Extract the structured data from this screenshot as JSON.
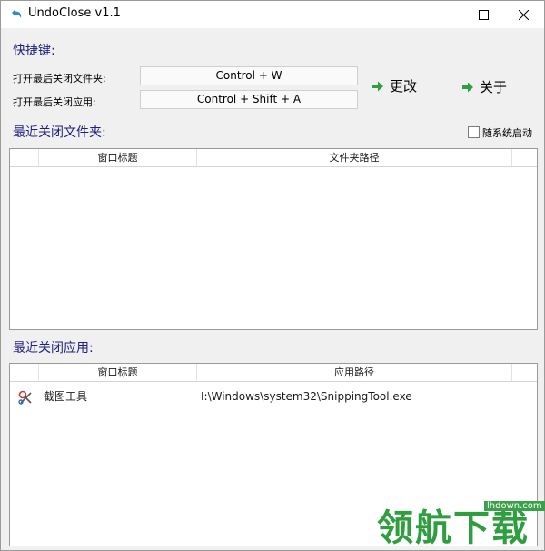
{
  "window": {
    "title": "UndoClose v1.1",
    "controls": {
      "minimize": "minimize-icon",
      "maximize": "maximize-icon",
      "close": "close-icon"
    }
  },
  "hotkeys": {
    "section_title": "快捷键:",
    "folder_label": "打开最后关闭文件夹:",
    "folder_value": "Control + W",
    "app_label": "打开最后关闭应用:",
    "app_value": "Control + Shift + A",
    "change_label": "更改",
    "about_label": "关于"
  },
  "startup": {
    "label": "随系统启动",
    "checked": false
  },
  "folders": {
    "section_title": "最近关闭文件夹:",
    "columns": [
      "窗口标题",
      "文件夹路径"
    ],
    "rows": []
  },
  "apps": {
    "section_title": "最近关闭应用:",
    "columns": [
      "窗口标题",
      "应用路径"
    ],
    "rows": [
      {
        "title": "截图工具",
        "path": "I:\\Windows\\system32\\SnippingTool.exe",
        "icon": "snipping-tool-icon"
      }
    ]
  },
  "watermark": {
    "text": "领航下载",
    "url": "lhdown.com"
  },
  "colors": {
    "accent_green": "#2e9e3e",
    "label_blue": "#1f1f80"
  }
}
